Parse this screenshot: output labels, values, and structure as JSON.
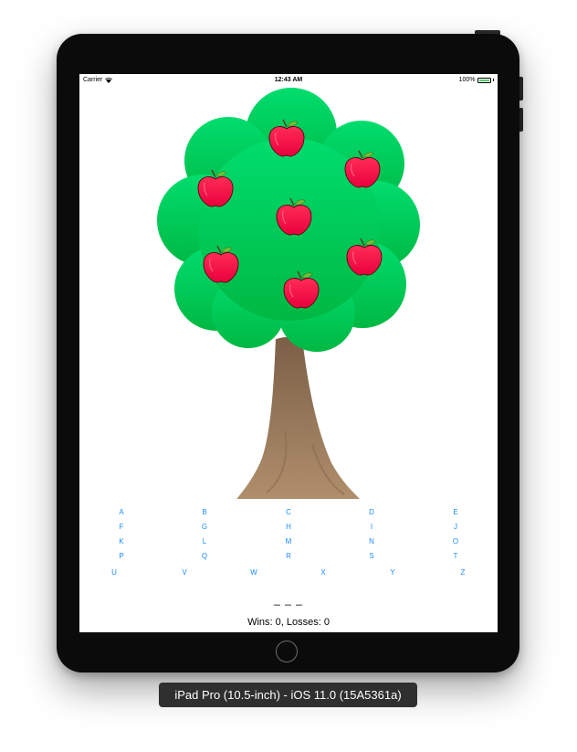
{
  "status_bar": {
    "carrier": "Carrier",
    "time": "12:43 AM",
    "battery": "100%"
  },
  "game": {
    "apples_count": 7,
    "letters": [
      [
        "A",
        "B",
        "C",
        "D",
        "E"
      ],
      [
        "F",
        "G",
        "H",
        "I",
        "J"
      ],
      [
        "K",
        "L",
        "M",
        "N",
        "O"
      ],
      [
        "P",
        "Q",
        "R",
        "S",
        "T"
      ],
      [
        "U",
        "V",
        "W",
        "X",
        "Y",
        "Z"
      ]
    ],
    "word_display": "_ _ _",
    "score_label": "Wins: 0, Losses: 0"
  },
  "simulator_caption": "iPad Pro (10.5-inch) - iOS 11.0 (15A5361a)",
  "colors": {
    "accent": "#1a8cff",
    "foliage": "#00c853",
    "apple": "#ff1744",
    "trunk": "#8d6e52"
  }
}
